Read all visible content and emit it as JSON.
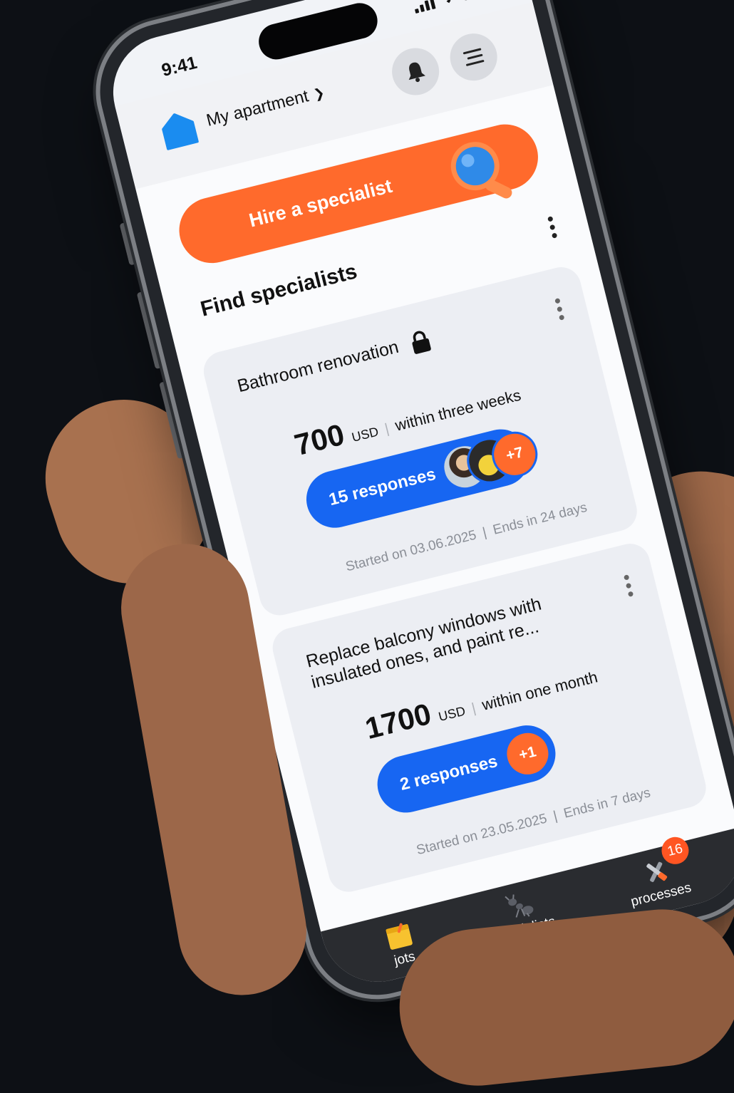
{
  "status": {
    "time": "9:41"
  },
  "header": {
    "apartment_label": "My apartment"
  },
  "hire_button": {
    "label": "Hire a specialist"
  },
  "section": {
    "title": "Find specialists"
  },
  "requests": [
    {
      "title": "Bathroom renovation",
      "price": "700",
      "currency": "USD",
      "term": "within three weeks",
      "responses_label": "15 responses",
      "more_count": "+7",
      "started": "Started on 03.06.2025",
      "ends": "Ends in 24 days"
    },
    {
      "title": "Replace balcony windows with insulated ones, and paint re...",
      "price": "1700",
      "currency": "USD",
      "term": "within one month",
      "responses_label": "2 responses",
      "more_count": "+1",
      "started": "Started on 23.05.2025",
      "ends": "Ends in 7 days"
    }
  ],
  "tabs": [
    {
      "label": "jots",
      "icon": "notepad-icon"
    },
    {
      "label": "specialists",
      "icon": "ant-icon"
    },
    {
      "label": "processes",
      "icon": "tools-icon",
      "badge": "16"
    }
  ],
  "colors": {
    "accent_orange": "#ff6a2c",
    "accent_blue": "#1766f2",
    "home_blue": "#1a8cf0"
  }
}
